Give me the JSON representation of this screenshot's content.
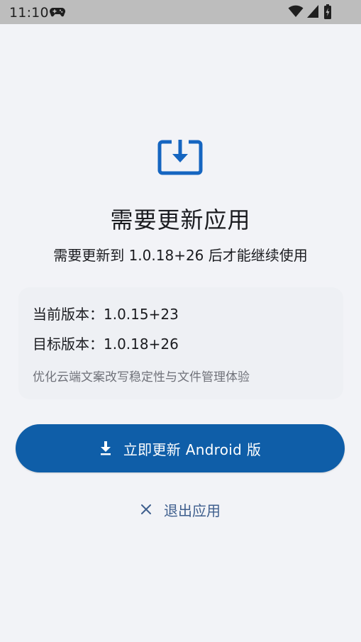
{
  "status_bar": {
    "time": "11:10",
    "icons": [
      "gamepad-icon",
      "wifi-icon",
      "signal-icon",
      "battery-icon"
    ]
  },
  "hero": {
    "icon": "download-box-icon",
    "color": "#1565c0"
  },
  "page": {
    "title": "需要更新应用",
    "subtitle": "需要更新到 1.0.18+26 后才能继续使用"
  },
  "info": {
    "current_version": "当前版本：1.0.15+23",
    "target_version": "目标版本：1.0.18+26",
    "description": "优化云端文案改写稳定性与文件管理体验"
  },
  "actions": {
    "update_label": "立即更新 Android 版",
    "update_icon": "download-icon",
    "exit_label": "退出应用",
    "exit_icon": "close-icon"
  },
  "colors": {
    "primary": "#0f5ea8",
    "background": "#f2f3f7",
    "card": "#eef0f4",
    "secondary_text": "#70727a",
    "link": "#3f5f8e"
  }
}
